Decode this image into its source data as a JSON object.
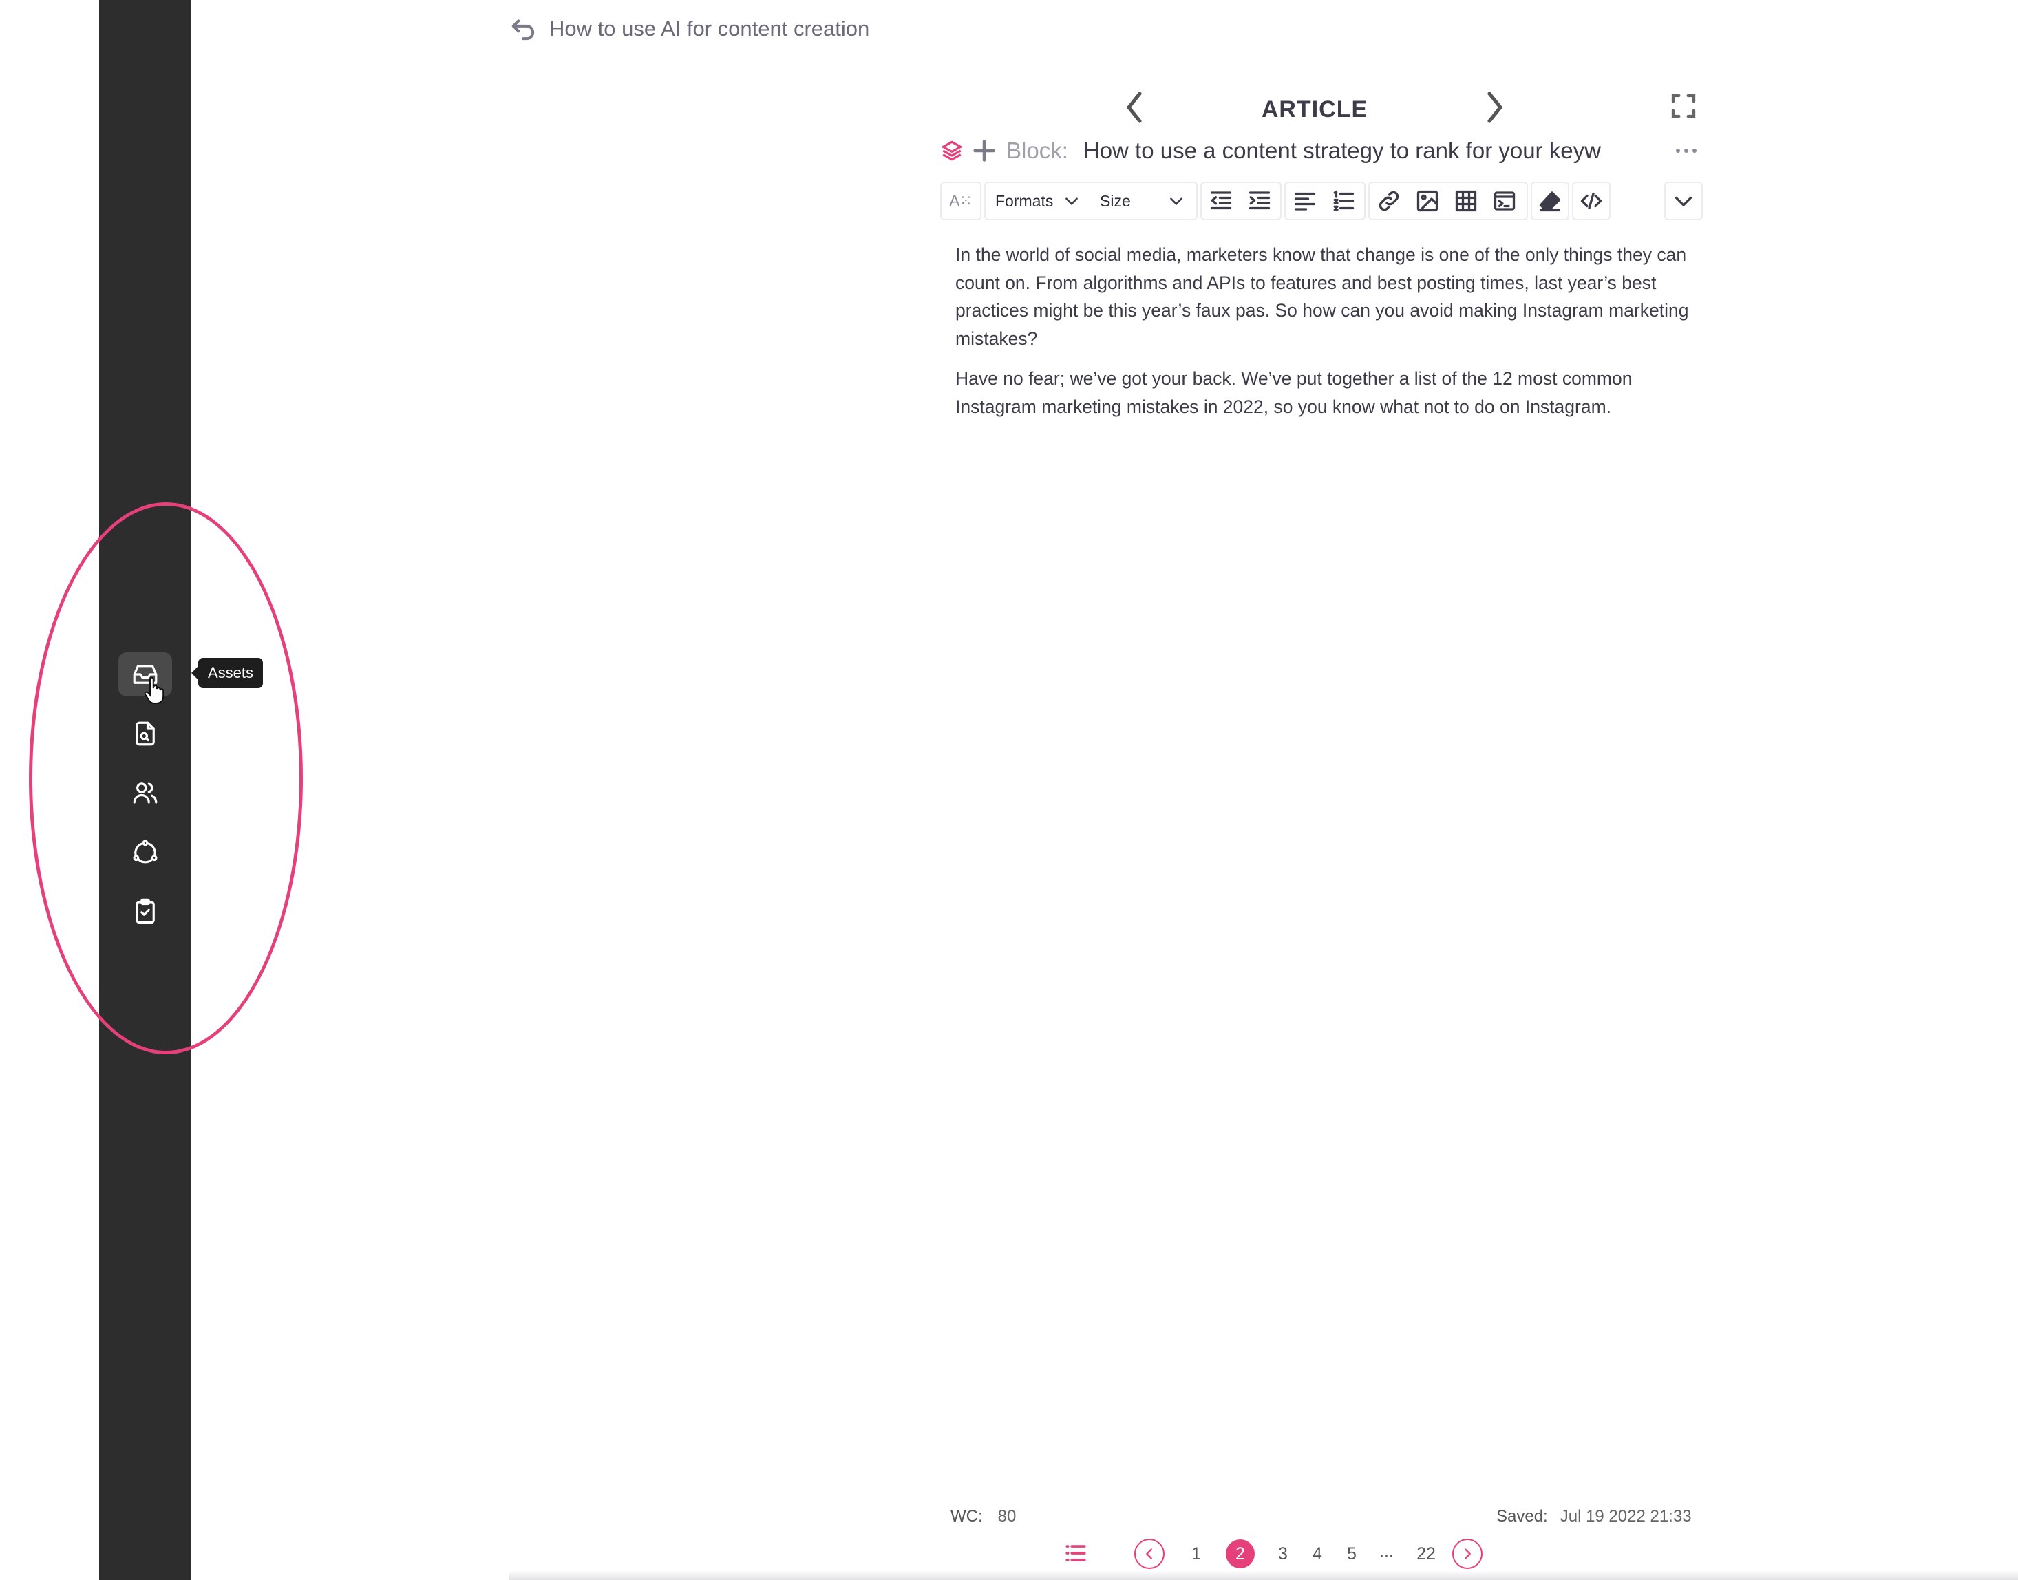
{
  "breadcrumb": {
    "back_icon": "undo-arrow-icon",
    "title": "How to use AI for content creation"
  },
  "sidebar": {
    "items": [
      {
        "name": "assets",
        "icon": "inbox-icon",
        "active": true
      },
      {
        "name": "search-document",
        "icon": "file-search-icon",
        "active": false
      },
      {
        "name": "users",
        "icon": "users-icon",
        "active": false
      },
      {
        "name": "workflow",
        "icon": "share-cycle-icon",
        "active": false
      },
      {
        "name": "tasks",
        "icon": "clipboard-check-icon",
        "active": false
      }
    ],
    "tooltip": "Assets"
  },
  "editor": {
    "header_title": "ARTICLE",
    "block_label": "Block:",
    "block_title": "How to use a content strategy to rank for your keyw",
    "toolbar": {
      "formats_label": "Formats",
      "size_label": "Size",
      "font_label": "A⁙"
    },
    "paragraphs": [
      "In the world of social media, marketers know that change is one of the only things they can count on. From algorithms and APIs to features and best posting times, last year’s best practices might be this year’s faux pas. So how can you avoid making Instagram marketing mistakes?",
      "Have no fear; we’ve got your back. We’ve put together a list of the 12 most common Instagram marketing mistakes in 2022, so you know what not to do on Instagram."
    ]
  },
  "footer": {
    "wc_label": "WC:",
    "wc_value": "80",
    "saved_label": "Saved:",
    "saved_value": "Jul 19 2022 21:33"
  },
  "pagination": {
    "pages": [
      "1",
      "2",
      "3",
      "4",
      "5"
    ],
    "current": "2",
    "ellipsis": "...",
    "last": "22"
  },
  "colors": {
    "accent": "#e5407a",
    "rail": "#2d2d2d"
  }
}
